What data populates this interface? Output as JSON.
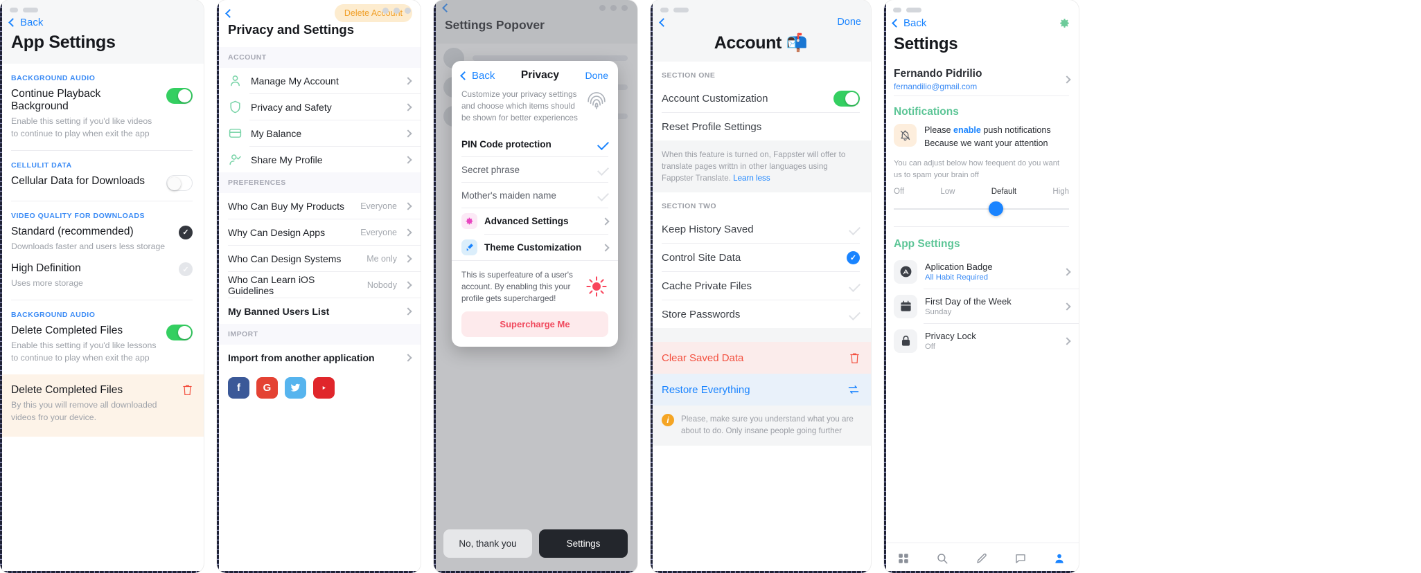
{
  "panel1": {
    "back_label": "Back",
    "title": "App Settings",
    "groups": [
      {
        "header": "BACKGROUND AUDIO",
        "title": "Continue Playback Background",
        "subtitle": "Enable this setting if you'd like videos to continue to play when exit the app",
        "control": "toggle-on"
      },
      {
        "header": "CELLULIT DATA",
        "title": "Cellular Data for Downloads",
        "subtitle": "",
        "control": "toggle-off"
      }
    ],
    "quality": {
      "header": "VIDEO QUALITY FOR DOWNLOADS",
      "options": [
        {
          "title": "Standard (recommended)",
          "subtitle": "Downloads faster and users less storage",
          "selected": true
        },
        {
          "title": "High Definition",
          "subtitle": "Uses more storage",
          "selected": false
        }
      ]
    },
    "delete_group": {
      "header": "BACKGROUND AUDIO",
      "title": "Delete Completed Files",
      "subtitle": "Enable this setting if you'd like lessons to continue to play when exit the app",
      "control": "toggle-on"
    },
    "danger": {
      "title": "Delete Completed Files",
      "subtitle": "By this you will remove all downloaded videos fro your device.",
      "icon": "trash-icon"
    }
  },
  "panel2": {
    "delete_account_label": "Delete Account",
    "title": "Privacy and Settings",
    "account_header": "ACCOUNT",
    "account_items": [
      {
        "label": "Manage My Account",
        "icon": "person-icon"
      },
      {
        "label": "Privacy and Safety",
        "icon": "shield-icon"
      },
      {
        "label": "My Balance",
        "icon": "card-icon"
      },
      {
        "label": "Share My Profile",
        "icon": "person-check-icon"
      }
    ],
    "preferences_header": "PREFERENCES",
    "preference_items": [
      {
        "label": "Who Can Buy My Products",
        "value": "Everyone"
      },
      {
        "label": "Why Can Design Apps",
        "value": "Everyone"
      },
      {
        "label": "Who Can Design Systems",
        "value": "Me only"
      },
      {
        "label": "Who Can Learn iOS Guidelines",
        "value": "Nobody"
      }
    ],
    "banned_label": "My Banned Users List",
    "import_header": "IMPORT",
    "import_label": "Import from another application",
    "socials": [
      {
        "name": "facebook-icon",
        "glyph": "f"
      },
      {
        "name": "google-icon",
        "glyph": "G"
      },
      {
        "name": "twitter-icon",
        "glyph": "ᴠ"
      },
      {
        "name": "youtube-icon",
        "glyph": "▶"
      }
    ]
  },
  "panel3": {
    "behind_title": "Settings Popover",
    "popover": {
      "back_label": "Back",
      "title": "Privacy",
      "done_label": "Done",
      "description": "Customize your privacy settings and choose which items should be shown for better experiences",
      "desc_icon": "fingerprint-icon",
      "options": [
        {
          "label": "PIN Code protection",
          "checked": true
        },
        {
          "label": "Secret phrase",
          "checked": false
        },
        {
          "label": "Mother's maiden name",
          "checked": false
        }
      ],
      "actions": [
        {
          "label": "Advanced Settings",
          "icon": "gear-icon"
        },
        {
          "label": "Theme Customization",
          "icon": "paint-icon"
        }
      ],
      "super_text": "This is superfeature of a user's account. By enabling this your profile gets supercharged!",
      "super_icon": "sun-icon",
      "cta_label": "Supercharge Me"
    },
    "bottom_buttons": [
      {
        "label": "No, thank you",
        "style": "light"
      },
      {
        "label": "Settings",
        "style": "dark"
      }
    ]
  },
  "panel4": {
    "done_label": "Done",
    "title": "Account 📬",
    "section_one_header": "SECTION ONE",
    "section_one_items": [
      {
        "label": "Account Customization",
        "control": "toggle-on"
      },
      {
        "label": "Reset Profile Settings",
        "control": "none"
      }
    ],
    "note": "When this feature is turned on, Fappster will offer to translate pages writtn in other languages using Fappster Translate.",
    "note_link": "Learn less",
    "section_two_header": "SECTION TWO",
    "section_two_items": [
      {
        "label": "Keep History Saved",
        "control": "gray-check"
      },
      {
        "label": "Control Site Data",
        "control": "blue-check"
      },
      {
        "label": "Cache Private Files",
        "control": "gray-check"
      },
      {
        "label": "Store Passwords",
        "control": "gray-check"
      }
    ],
    "clear_label": "Clear Saved Data",
    "clear_icon": "trash-icon",
    "restore_label": "Restore Everything",
    "restore_icon": "refresh-icon",
    "warn_icon": "info-icon",
    "warn_text": "Please, make sure you understand what you are about to do. Only insane people going further"
  },
  "panel5": {
    "back_label": "Back",
    "gear_icon": "gear-icon",
    "title": "Settings",
    "profile": {
      "name": "Fernando Pidrilio",
      "email": "fernandilio@gmail.com"
    },
    "notifications_title": "Notifications",
    "notification_icon": "bell-off-icon",
    "notification_text_before": "Please ",
    "notification_link": "enable",
    "notification_text_after": " push notifications Because we want your attention",
    "adjust_text": "You can adjust below how feequent do you want us to spam your brain off",
    "slider": {
      "labels": [
        "Off",
        "Low",
        "Default",
        "High"
      ],
      "active": "Default",
      "value_percent": 58
    },
    "app_settings_title": "App Settings",
    "app_items": [
      {
        "label": "Aplication Badge",
        "value": "All Habit Required",
        "value_style": "link",
        "icon": "appstore-icon"
      },
      {
        "label": "First Day of the Week",
        "value": "Sunday",
        "value_style": "gray",
        "icon": "calendar-icon"
      },
      {
        "label": "Privacy Lock",
        "value": "Off",
        "value_style": "gray",
        "icon": "lock-icon"
      }
    ],
    "tabs": [
      {
        "name": "grid-icon"
      },
      {
        "name": "search-icon"
      },
      {
        "name": "pencil-icon"
      },
      {
        "name": "chat-icon"
      },
      {
        "name": "profile-icon"
      }
    ]
  },
  "colors": {
    "blue": "#1a84ff",
    "green": "#34cf61",
    "mint": "#5cc596",
    "red": "#f3503f",
    "orange": "#f0a02a"
  }
}
